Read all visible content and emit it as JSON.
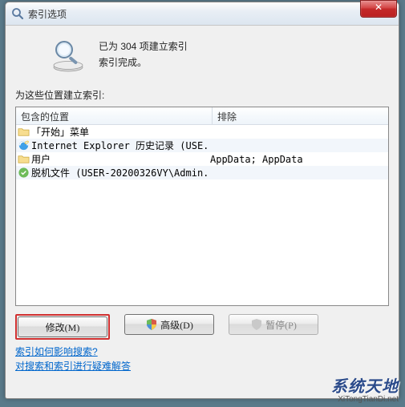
{
  "window": {
    "title": "索引选项",
    "close_symbol": "✕"
  },
  "status": {
    "line1": "已为 304 项建立索引",
    "line2": "索引完成。"
  },
  "section_label": "为这些位置建立索引:",
  "list": {
    "col1_header": "包含的位置",
    "col2_header": "排除",
    "rows": [
      {
        "icon": "folder",
        "label": "「开始」菜单",
        "exclude": ""
      },
      {
        "icon": "ie",
        "label": "Internet Explorer 历史记录 (USE...",
        "exclude": ""
      },
      {
        "icon": "folder",
        "label": "用户",
        "exclude": "AppData; AppData"
      },
      {
        "icon": "offline",
        "label": "脱机文件 (USER-20200326VY\\Admin...",
        "exclude": ""
      }
    ]
  },
  "buttons": {
    "modify": "修改(M)",
    "advanced": "高级(D)",
    "pause": "暂停(P)"
  },
  "links": {
    "help1": "索引如何影响搜索?",
    "help2": "对搜索和索引进行疑难解答"
  },
  "watermark": {
    "main": "系统天地",
    "sub": "XiTongTianDi.net"
  }
}
